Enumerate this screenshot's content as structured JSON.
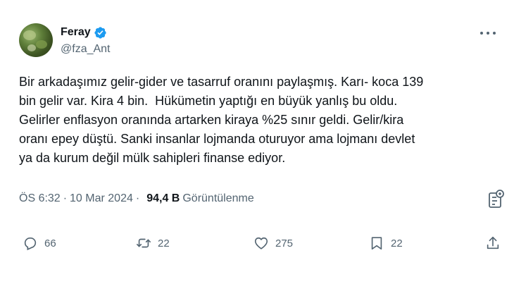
{
  "author": {
    "display_name": "Feray",
    "handle": "@fza_Ant",
    "avatar_icon": "avatar",
    "verified_icon": "verified-badge-icon",
    "verified_color": "#1d9bf0"
  },
  "post": {
    "text": "Bir arkadaşımız gelir-gider ve tasarruf oranını paylaşmış. Karı- koca 139\nbin gelir var. Kira 4 bin.  Hükümetin yaptığı en büyük yanlış bu oldu.\nGelirler enflasyon oranında artarken kiraya %25 sınır geldi. Gelir/kira\noranı epey düştü. Sanki insanlar lojmanda oturuyor ama lojmanı devlet\nya da kurum değil mülk sahipleri finanse ediyor.",
    "time": "ÖS 6:32",
    "date": "10 Mar 2024",
    "separator": "·",
    "views_count": "94,4 B",
    "views_label": "Görüntülenme"
  },
  "actions": {
    "replies": "66",
    "reposts": "22",
    "likes": "275",
    "bookmarks": "22"
  },
  "icons": {
    "more": "more-icon",
    "analytics": "analytics-icon",
    "reply": "reply-icon",
    "repost": "repost-icon",
    "like": "like-icon",
    "bookmark": "bookmark-icon",
    "share": "share-icon"
  },
  "colors": {
    "text": "#0f1419",
    "secondary": "#536471",
    "accent": "#1d9bf0"
  }
}
